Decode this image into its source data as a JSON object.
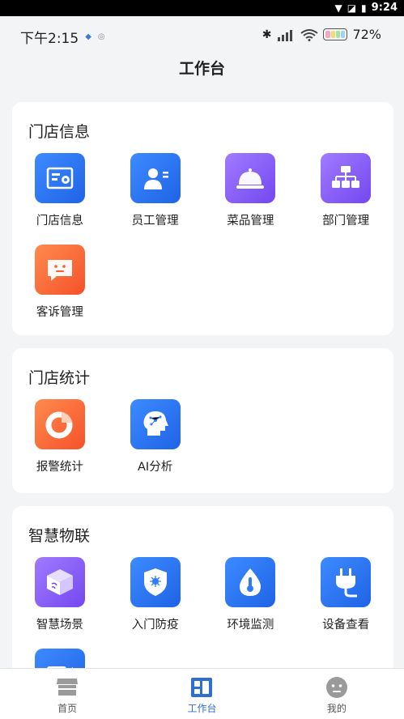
{
  "system_bar": {
    "time": "9:24"
  },
  "status_bar": {
    "time": "下午2:15",
    "battery": "72%"
  },
  "page_title": "工作台",
  "sections": [
    {
      "title": "门店信息",
      "items": [
        {
          "label": "门店信息",
          "icon": "store-info-icon",
          "color": "#2f7cf6"
        },
        {
          "label": "员工管理",
          "icon": "employee-icon",
          "color": "#2f7cf6"
        },
        {
          "label": "菜品管理",
          "icon": "dish-cloche-icon",
          "color": "#8a5cf5"
        },
        {
          "label": "部门管理",
          "icon": "org-chart-icon",
          "color": "#8a5cf5"
        },
        {
          "label": "客诉管理",
          "icon": "complaint-icon",
          "color": "#fb6a3a"
        }
      ]
    },
    {
      "title": "门店统计",
      "items": [
        {
          "label": "报警统计",
          "icon": "pie-chart-icon",
          "color": "#fb6a3a"
        },
        {
          "label": "AI分析",
          "icon": "ai-head-icon",
          "color": "#2f7cf6"
        }
      ]
    },
    {
      "title": "智慧物联",
      "items": [
        {
          "label": "智慧场景",
          "icon": "smart-box-icon",
          "color": "#8a5cf5"
        },
        {
          "label": "入门防疫",
          "icon": "shield-virus-icon",
          "color": "#2f7cf6"
        },
        {
          "label": "环境监测",
          "icon": "thermometer-drop-icon",
          "color": "#2f7cf6"
        },
        {
          "label": "设备查看",
          "icon": "plug-icon",
          "color": "#2f7cf6"
        }
      ]
    }
  ],
  "bottom_nav": [
    {
      "label": "首页",
      "icon": "store-front-icon",
      "active": false
    },
    {
      "label": "工作台",
      "icon": "workbench-icon",
      "active": true
    },
    {
      "label": "我的",
      "icon": "face-icon",
      "active": false
    }
  ]
}
